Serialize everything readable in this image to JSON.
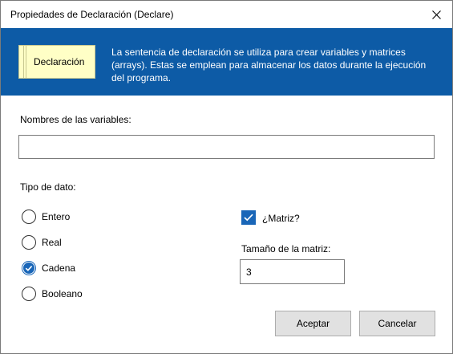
{
  "window": {
    "title": "Propiedades de Declaración (Declare)"
  },
  "banner": {
    "card_label": "Declaración",
    "description": "La sentencia de declaración se utiliza para crear variables y matrices (arrays). Estas se emplean para almacenar los datos durante la ejecución del programa."
  },
  "variables": {
    "label": "Nombres de las variables:",
    "value": ""
  },
  "data_type": {
    "label": "Tipo de dato:",
    "options": [
      {
        "label": "Entero",
        "selected": false
      },
      {
        "label": "Real",
        "selected": false
      },
      {
        "label": "Cadena",
        "selected": true
      },
      {
        "label": "Booleano",
        "selected": false
      }
    ]
  },
  "matrix": {
    "checkbox_label": "¿Matriz?",
    "checked": true,
    "size_label": "Tamaño de la matriz:",
    "size_value": "3"
  },
  "buttons": {
    "accept": "Aceptar",
    "cancel": "Cancelar"
  },
  "colors": {
    "accent": "#1966b8",
    "banner": "#0d5ba6",
    "card": "#ffffc6"
  }
}
